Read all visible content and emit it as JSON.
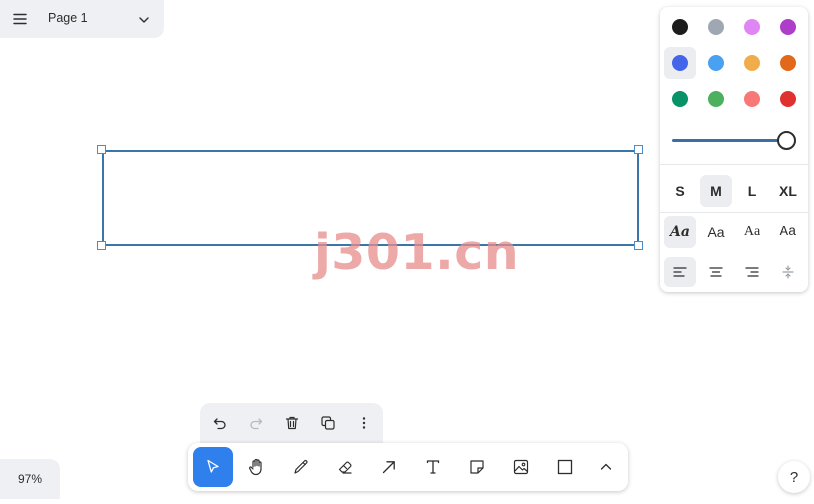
{
  "page_menu": {
    "page_name": "Page 1"
  },
  "watermark": "j301.cn",
  "style_panel": {
    "colors": [
      {
        "name": "black",
        "hex": "#1d1d1d"
      },
      {
        "name": "grey",
        "hex": "#9fa8b2"
      },
      {
        "name": "light-violet",
        "hex": "#e085f4"
      },
      {
        "name": "violet",
        "hex": "#ae3ec9"
      },
      {
        "name": "blue",
        "hex": "#4465e9",
        "selected": true
      },
      {
        "name": "light-blue",
        "hex": "#4ba1f1"
      },
      {
        "name": "yellow",
        "hex": "#f1ac4b"
      },
      {
        "name": "orange",
        "hex": "#e16919"
      },
      {
        "name": "green",
        "hex": "#099268"
      },
      {
        "name": "light-green",
        "hex": "#4cb05e"
      },
      {
        "name": "light-red",
        "hex": "#f87777"
      },
      {
        "name": "red",
        "hex": "#e03131"
      }
    ],
    "opacity": 1.0,
    "sizes": [
      {
        "label": "S",
        "selected": false
      },
      {
        "label": "M",
        "selected": true
      },
      {
        "label": "L",
        "selected": false
      },
      {
        "label": "XL",
        "selected": false
      }
    ],
    "fonts": [
      {
        "label": "Aa",
        "name": "draw",
        "selected": true
      },
      {
        "label": "Aa",
        "name": "sans",
        "selected": false
      },
      {
        "label": "Aa",
        "name": "serif",
        "selected": false
      },
      {
        "label": "Aa",
        "name": "mono",
        "selected": false
      }
    ],
    "align": [
      "align-left-icon",
      "align-center-icon",
      "align-right-icon",
      "vertical-align-icon"
    ]
  },
  "action_bar": [
    "undo-icon",
    "redo-icon",
    "trash-icon",
    "duplicate-icon",
    "more-icon"
  ],
  "toolbar": [
    "select-icon",
    "hand-icon",
    "draw-icon",
    "eraser-icon",
    "arrow-icon",
    "text-icon",
    "note-icon",
    "image-icon",
    "rectangle-icon",
    "chevron-up-icon"
  ],
  "zoom": {
    "label": "97%"
  },
  "help": {
    "label": "?"
  },
  "accent": "#2f80ed"
}
